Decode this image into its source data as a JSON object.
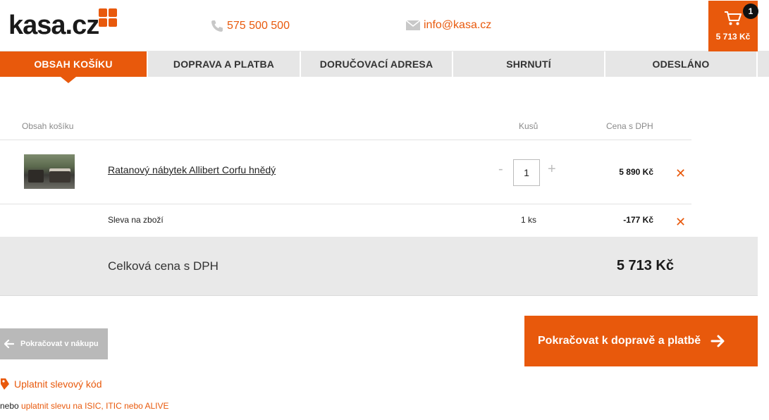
{
  "header": {
    "logo_text": "kasa.cz",
    "phone": "575 500 500",
    "email": "info@kasa.cz",
    "cart_count": "1",
    "cart_total": "5 713 Kč"
  },
  "steps": [
    {
      "label": "OBSAH KOŠÍKU",
      "active": true
    },
    {
      "label": "DOPRAVA A PLATBA",
      "active": false
    },
    {
      "label": "DORUČOVACÍ ADRESA",
      "active": false
    },
    {
      "label": "SHRNUTÍ",
      "active": false
    },
    {
      "label": "ODESLÁNO",
      "active": false
    }
  ],
  "table": {
    "col_content": "Obsah košíku",
    "col_qty": "Kusů",
    "col_price": "Cena s DPH"
  },
  "items": [
    {
      "name": "Ratanový nábytek Allibert Corfu hnědý",
      "qty": "1",
      "price": "5 890 Kč"
    }
  ],
  "discount": {
    "label": "Sleva na zboží",
    "qty": "1 ks",
    "price": "-177 Kč"
  },
  "total": {
    "label": "Celková cena s DPH",
    "value": "5 713 Kč"
  },
  "buttons": {
    "back": "Pokračovat v nákupu",
    "next": "Pokračovat k dopravě a platbě"
  },
  "coupon": {
    "label": "Uplatnit slevový kód",
    "prefix": "nebo ",
    "isic_link": "uplatnit slevu na ISIC, ITIC nebo ALIVE"
  },
  "icons": {
    "phone": "phone-icon",
    "email": "envelope-icon",
    "cart": "cart-icon",
    "remove": "close-icon",
    "back": "arrow-left-icon",
    "next": "arrow-right-icon",
    "coupon": "tag-icon"
  },
  "colors": {
    "accent": "#e8590c",
    "step_bg": "#e6e6e6",
    "back_button": "#b9b9b9",
    "total_band": "#e9e9e9"
  }
}
